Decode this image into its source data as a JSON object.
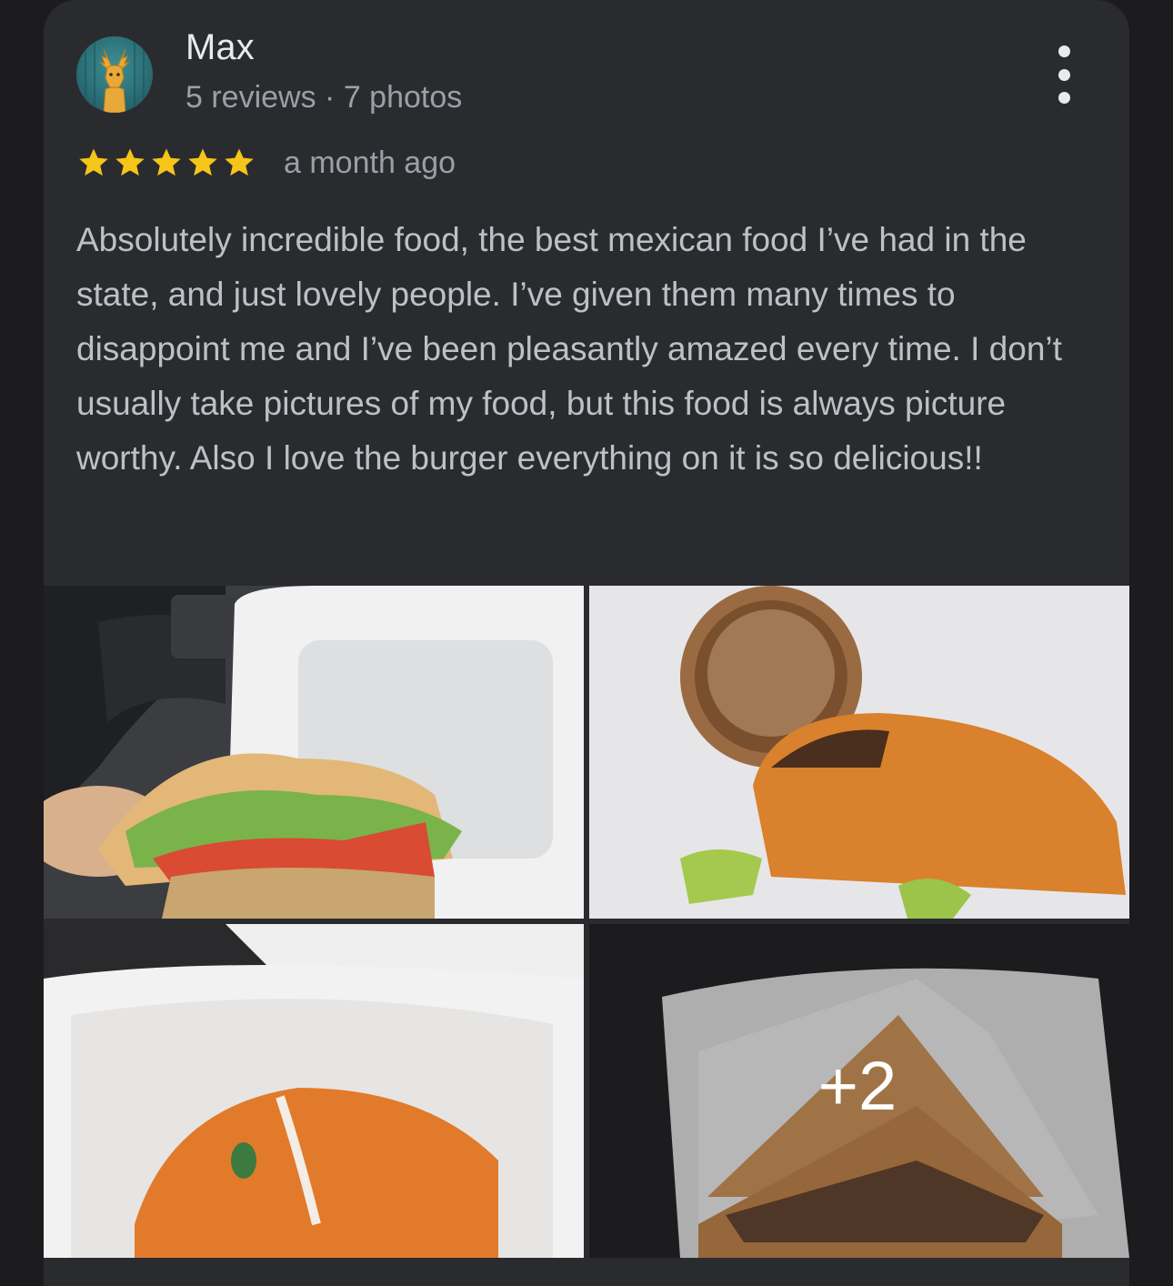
{
  "review": {
    "author": "Max",
    "author_meta": "5 reviews · 7 photos",
    "rating": 5,
    "rating_max": 5,
    "time_ago": "a month ago",
    "text": "Absolutely incredible food, the best mexican food I’ve had in the state, and just lovely people. I’ve given them many times to disappoint me and I’ve been pleasantly amazed every time. I don’t usually take pictures of my food, but this food is always picture worthy. Also I love the burger everything on it is so delicious!!",
    "more_photos_label": "+2"
  },
  "icons": {
    "avatar": "deer-avatar",
    "menu": "more-vert-icon",
    "star": "star-icon"
  },
  "colors": {
    "star": "#f5c518",
    "card_bg": "#2a2b2f",
    "page_bg": "#1c1c1e"
  }
}
